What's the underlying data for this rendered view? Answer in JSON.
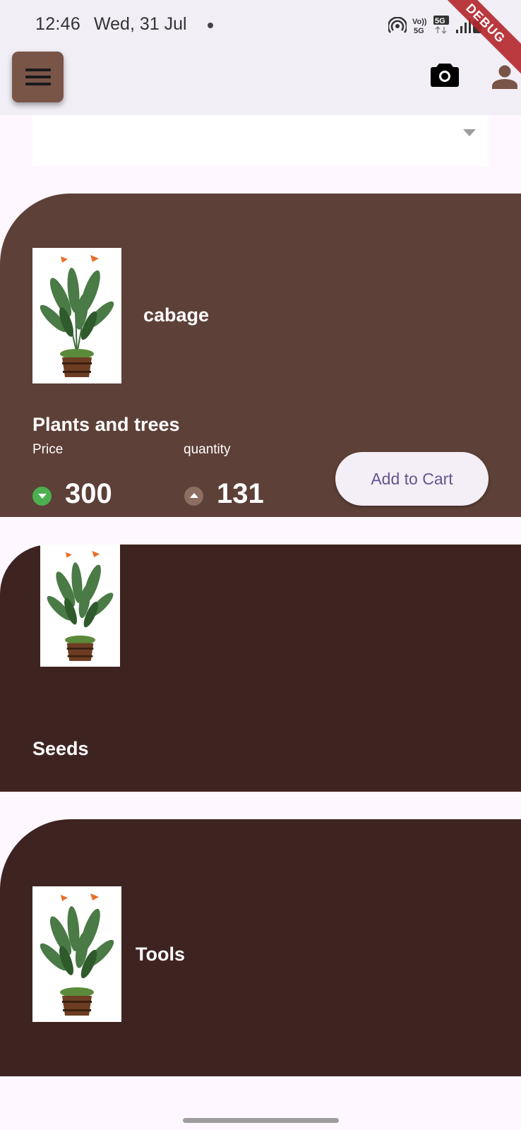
{
  "status_bar": {
    "time": "12:46",
    "date": "Wed, 31 Jul",
    "debug_label": "DEBUG"
  },
  "app_bar": {
    "menu_icon": "hamburger-menu-icon",
    "camera_icon": "camera-icon",
    "account_icon": "person-icon"
  },
  "dropdown": {
    "selected_value": ""
  },
  "cards": [
    {
      "name": "cabage",
      "category": "Plants and trees",
      "price_label": "Price",
      "price_value": "300",
      "quantity_label": "quantity",
      "quantity_value": "131",
      "button_label": "Add to Cart"
    },
    {
      "category": "Seeds"
    },
    {
      "name": "Tools"
    }
  ],
  "colors": {
    "card_primary": "#5d4037",
    "card_dark": "#3e2421",
    "menu_button": "#795548",
    "price_indicator": "#4caf50",
    "button_text": "#65558f",
    "background": "#fef7ff"
  }
}
